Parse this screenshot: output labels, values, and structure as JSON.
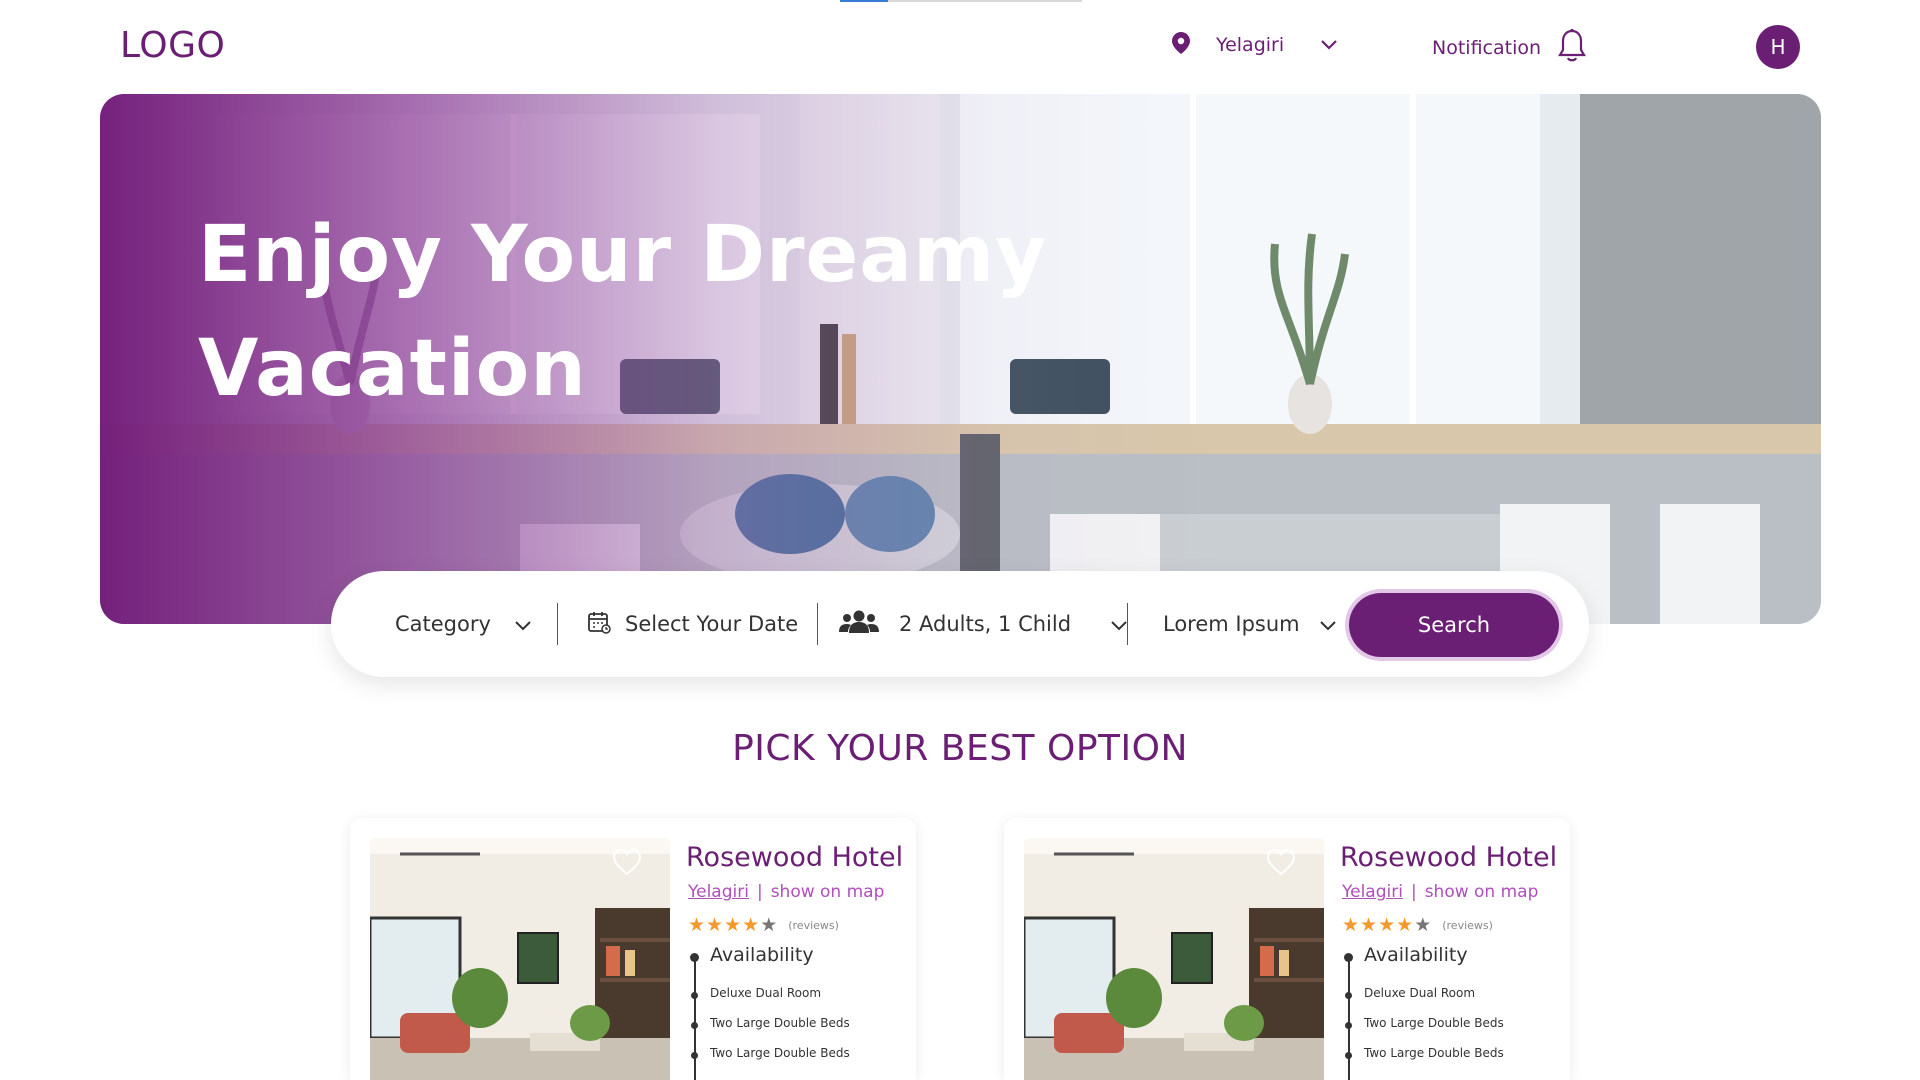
{
  "header": {
    "logo": "LOGO",
    "location": {
      "label": "Yelagiri",
      "icon": "map-pin-icon"
    },
    "notification": {
      "label": "Notification",
      "icon": "bell-icon"
    },
    "avatar_initial": "H"
  },
  "hero": {
    "title_line1": "Enjoy Your Dreamy",
    "title_line2": "Vacation"
  },
  "search": {
    "category": "Category",
    "date": "Select Your Date",
    "guests": "2 Adults, 1 Child",
    "extra": "Lorem Ipsum",
    "button": "Search"
  },
  "section_title": "PICK YOUR BEST OPTION",
  "cards": [
    {
      "name": "Rosewood Hotel",
      "city": "Yelagiri",
      "map_link": "show on map",
      "rating": 4,
      "rating_max": 5,
      "reviews": "(reviews)",
      "availability_title": "Availability",
      "rooms": [
        "Deluxe Dual Room",
        "Two Large Double Beds",
        "Two Large Double Beds"
      ]
    },
    {
      "name": "Rosewood Hotel",
      "city": "Yelagiri",
      "map_link": "show on map",
      "rating": 4,
      "rating_max": 5,
      "reviews": "(reviews)",
      "availability_title": "Availability",
      "rooms": [
        "Deluxe Dual Room",
        "Two Large Double Beds",
        "Two Large Double Beds"
      ]
    }
  ],
  "colors": {
    "brand": "#6b1f74",
    "accent_link": "#b04fbc",
    "star": "#f39a2b"
  }
}
